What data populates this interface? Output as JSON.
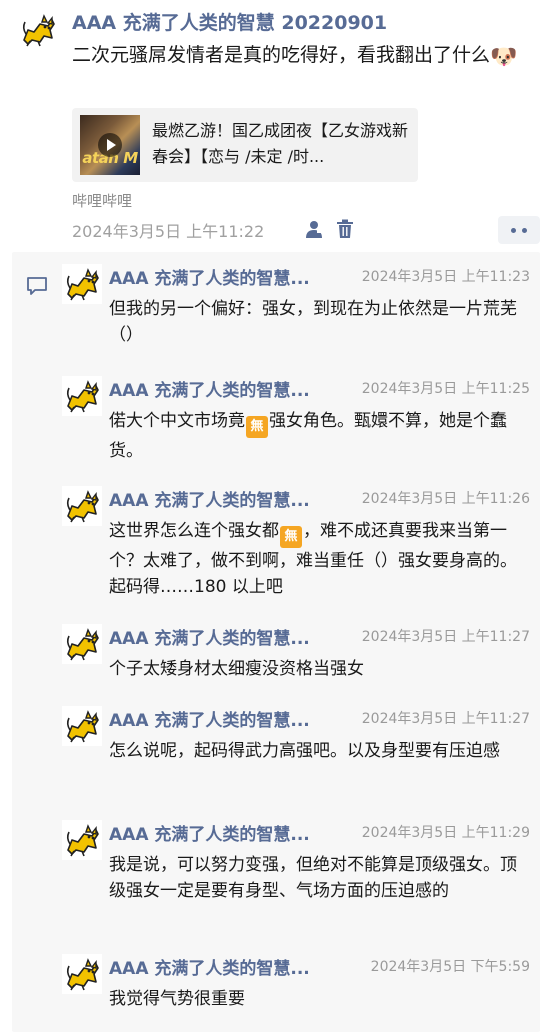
{
  "post": {
    "author": "AAA 充满了人类的智慧 20220901",
    "text": "二次元骚屌发情者是真的吃得好，看我翻出了什么",
    "link_card": {
      "title": "最燃乙游！国乙成团夜【乙女游戏新春会】【恋与 /未定 /时...",
      "thumb_text": "atan M"
    },
    "source": "哔哩哔哩",
    "time": "2024年3月5日 上午11:22"
  },
  "comments": [
    {
      "author": "AAA 充满了人类的智慧...",
      "time": "2024年3月5日 上午11:23",
      "text_parts": [
        "但我的另一个偏好：强女，到现在为止依然是一片荒芜（）"
      ]
    },
    {
      "author": "AAA 充满了人类的智慧...",
      "time": "2024年3月5日 上午11:25",
      "text_parts": [
        "偌大个中文市场竟",
        "强女角色。甄嬛不算，她是个蠢货。"
      ]
    },
    {
      "author": "AAA 充满了人类的智慧...",
      "time": "2024年3月5日 上午11:26",
      "text_parts": [
        "这世界怎么连个强女都",
        "，难不成还真要我来当第一个？太难了，做不到啊，难当重任（）强女要身高的。起码得……180 以上吧"
      ]
    },
    {
      "author": "AAA 充满了人类的智慧...",
      "time": "2024年3月5日 上午11:27",
      "text_parts": [
        "个子太矮身材太细瘦没资格当强女"
      ]
    },
    {
      "author": "AAA 充满了人类的智慧...",
      "time": "2024年3月5日 上午11:27",
      "text_parts": [
        "怎么说呢，起码得武力高强吧。以及身型要有压迫感"
      ]
    },
    {
      "author": "AAA 充满了人类的智慧...",
      "time": "2024年3月5日 上午11:29",
      "text_parts": [
        "我是说，可以努力变强，但绝对不能算是顶级强女。顶级强女一定是要有身型、气场方面的压迫感的"
      ]
    },
    {
      "author": "AAA 充满了人类的智慧...",
      "time": "2024年3月5日 下午5:59",
      "text_parts": [
        "我觉得气势很重要"
      ]
    }
  ],
  "emoji": {
    "wu": "無",
    "dog_face": "🐶"
  },
  "colors": {
    "name_blue": "#576b95",
    "wu_badge": "#f5a623",
    "comment_bg": "#f7f7f7",
    "time_gray": "#a0a0a0"
  },
  "icons": [
    "cat-avatar-icon",
    "video-play-icon",
    "person-icon",
    "trash-icon",
    "more-dots-icon",
    "comment-bubble-icon"
  ]
}
